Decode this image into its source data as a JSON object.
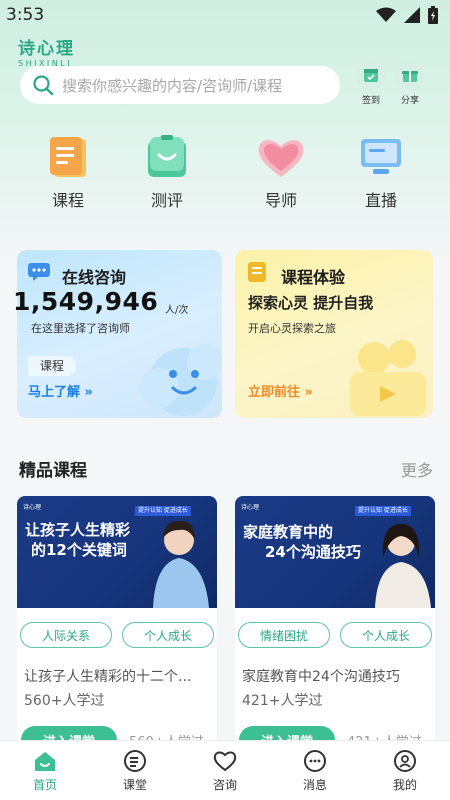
{
  "status_bar": {
    "time": "3:53"
  },
  "brand": {
    "name": "诗心理",
    "sub": "SHIXINLI"
  },
  "search": {
    "placeholder": "搜索你感兴趣的内容/咨询师/课程"
  },
  "header_actions": [
    {
      "label": "签到",
      "icon": "calendar-check-icon"
    },
    {
      "label": "分享",
      "icon": "gift-icon"
    }
  ],
  "categories": [
    {
      "label": "课程",
      "icon": "book-icon",
      "color": "#f5a54a"
    },
    {
      "label": "测评",
      "icon": "smile-clipboard-icon",
      "color": "#49c99a"
    },
    {
      "label": "导师",
      "icon": "heart-icon",
      "color": "#f39aa7"
    },
    {
      "label": "直播",
      "icon": "monitor-icon",
      "color": "#5aa6f0"
    }
  ],
  "consult_card": {
    "title": "在线咨询",
    "count": "1,549,946",
    "unit": "人/次",
    "desc": "在这里选择了咨询师",
    "tag": "课程",
    "link": "马上了解 »"
  },
  "course_card": {
    "title": "课程体验",
    "subtitle": "探索心灵 提升自我",
    "desc": "开启心灵探索之旅",
    "link": "立即前往 »"
  },
  "featured": {
    "title": "精品课程",
    "more": "更多"
  },
  "courses": [
    {
      "cover_title_1": "让孩子人生精彩",
      "cover_title_2": "的12个关键词",
      "badge": "提升认知 促进成长",
      "tags": [
        "人际关系",
        "个人成长"
      ],
      "name": "让孩子人生精彩的十二个...",
      "learners": "560+人学过",
      "enter": "进入课堂",
      "enter_count": "560+人学过"
    },
    {
      "cover_title_1": "家庭教育中的",
      "cover_title_2": "24个沟通技巧",
      "badge": "提升认知 促进成长",
      "tags": [
        "情绪困扰",
        "个人成长"
      ],
      "name": "家庭教育中24个沟通技巧",
      "learners": "421+人学过",
      "enter": "进入课堂",
      "enter_count": "421+人学过"
    }
  ],
  "tabbar": [
    {
      "label": "首页",
      "icon": "home-icon",
      "active": true
    },
    {
      "label": "课堂",
      "icon": "classroom-icon",
      "active": false
    },
    {
      "label": "咨询",
      "icon": "heart-outline-icon",
      "active": false
    },
    {
      "label": "消息",
      "icon": "message-icon",
      "active": false
    },
    {
      "label": "我的",
      "icon": "profile-icon",
      "active": false
    }
  ],
  "colors": {
    "accent": "#2aa884",
    "accent_button": "#3cbf92"
  }
}
